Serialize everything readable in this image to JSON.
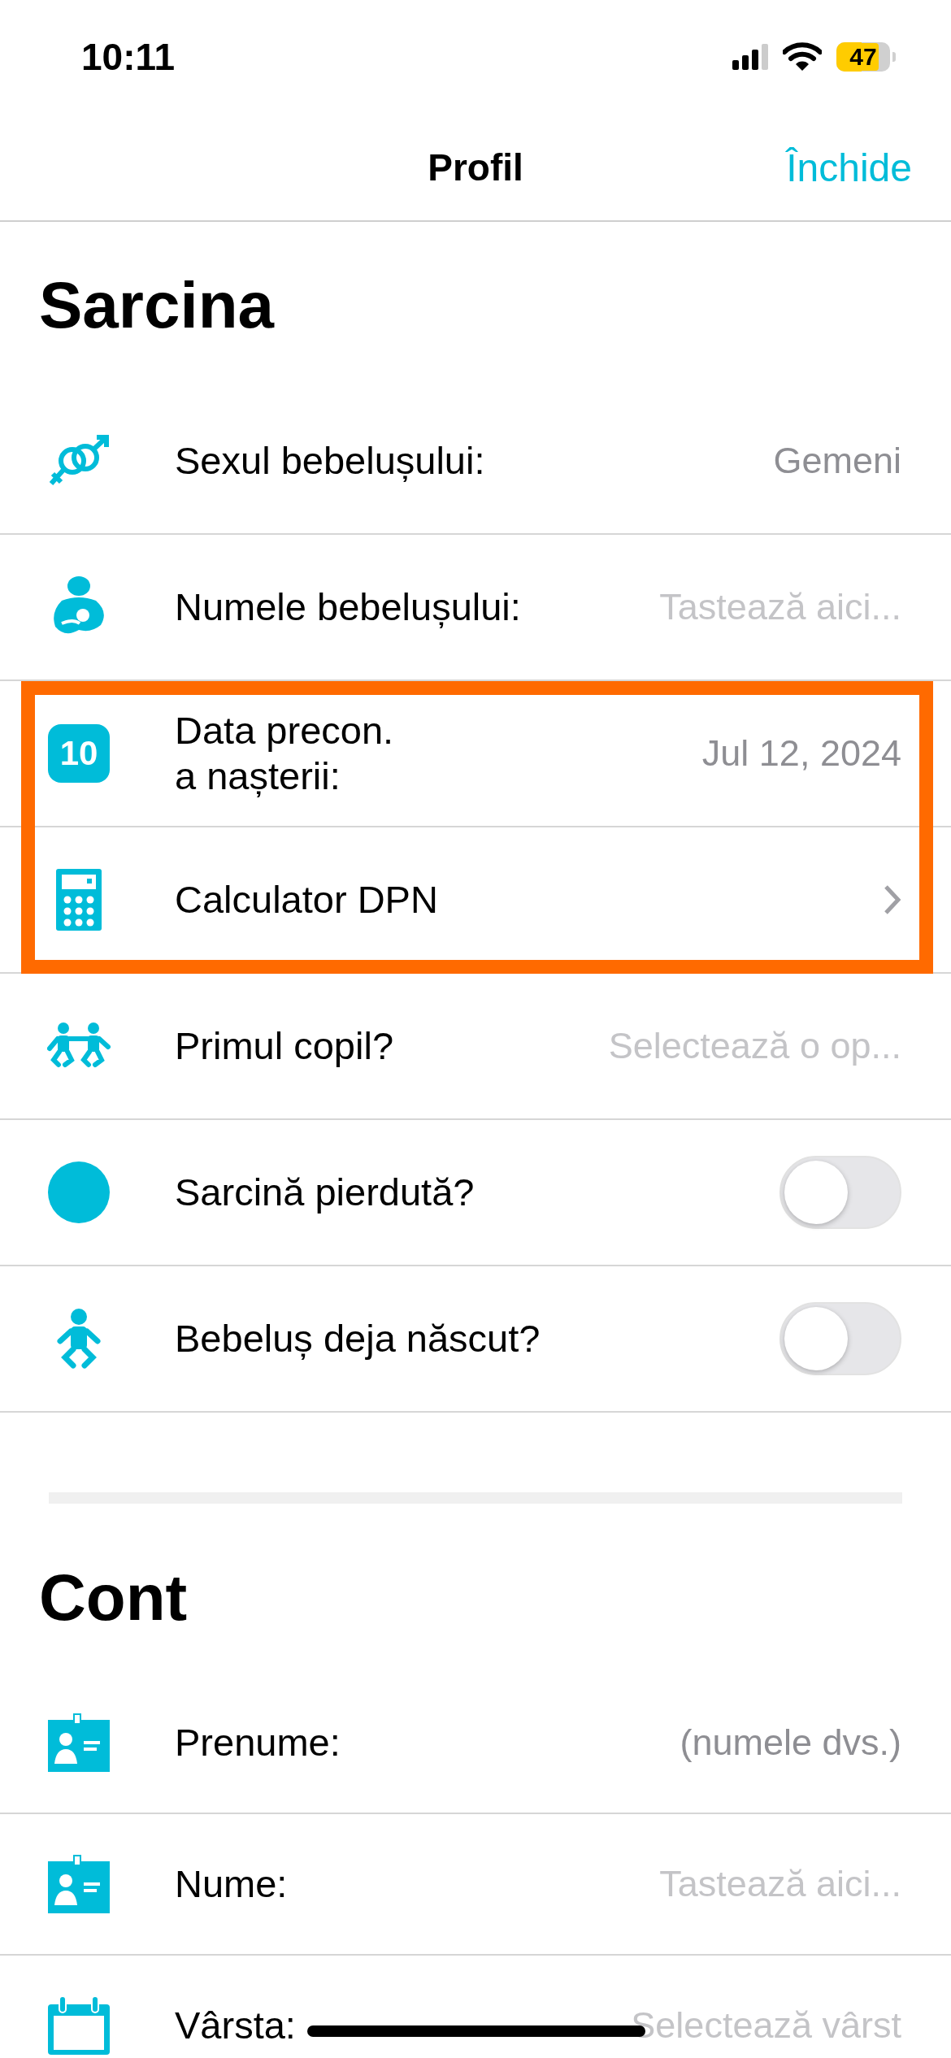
{
  "status_bar": {
    "time": "10:11",
    "battery": "47"
  },
  "nav": {
    "title": "Profil",
    "action": "Închide"
  },
  "sections": [
    {
      "title": "Sarcina",
      "rows": [
        {
          "kind": "value",
          "label": "Sexul bebelușului:",
          "value": "Gemeni",
          "highlighted": false
        },
        {
          "kind": "input",
          "label": "Numele bebelușului:",
          "placeholder": "Tastează aici...",
          "highlighted": false
        },
        {
          "kind": "value",
          "label": "Data precon.\na nașterii:",
          "value": "Jul 12, 2024",
          "icon_text": "10",
          "highlighted": true
        },
        {
          "kind": "link",
          "label": "Calculator DPN",
          "highlighted": true
        },
        {
          "kind": "select",
          "label": "Primul copil?",
          "placeholder": "Selectează o op...",
          "highlighted": false
        },
        {
          "kind": "toggle",
          "label": "Sarcină pierdută?",
          "on": false,
          "highlighted": false
        },
        {
          "kind": "toggle",
          "label": "Bebeluș deja născut?",
          "on": false,
          "highlighted": false
        }
      ]
    },
    {
      "title": "Cont",
      "rows": [
        {
          "kind": "value",
          "label": "Prenume:",
          "value": "(numele dvs.)",
          "highlighted": false
        },
        {
          "kind": "input",
          "label": "Nume:",
          "placeholder": "Tastează aici...",
          "highlighted": false
        },
        {
          "kind": "select",
          "label": "Vârsta:",
          "placeholder": "Selectează vârst",
          "highlighted": false
        }
      ]
    }
  ]
}
